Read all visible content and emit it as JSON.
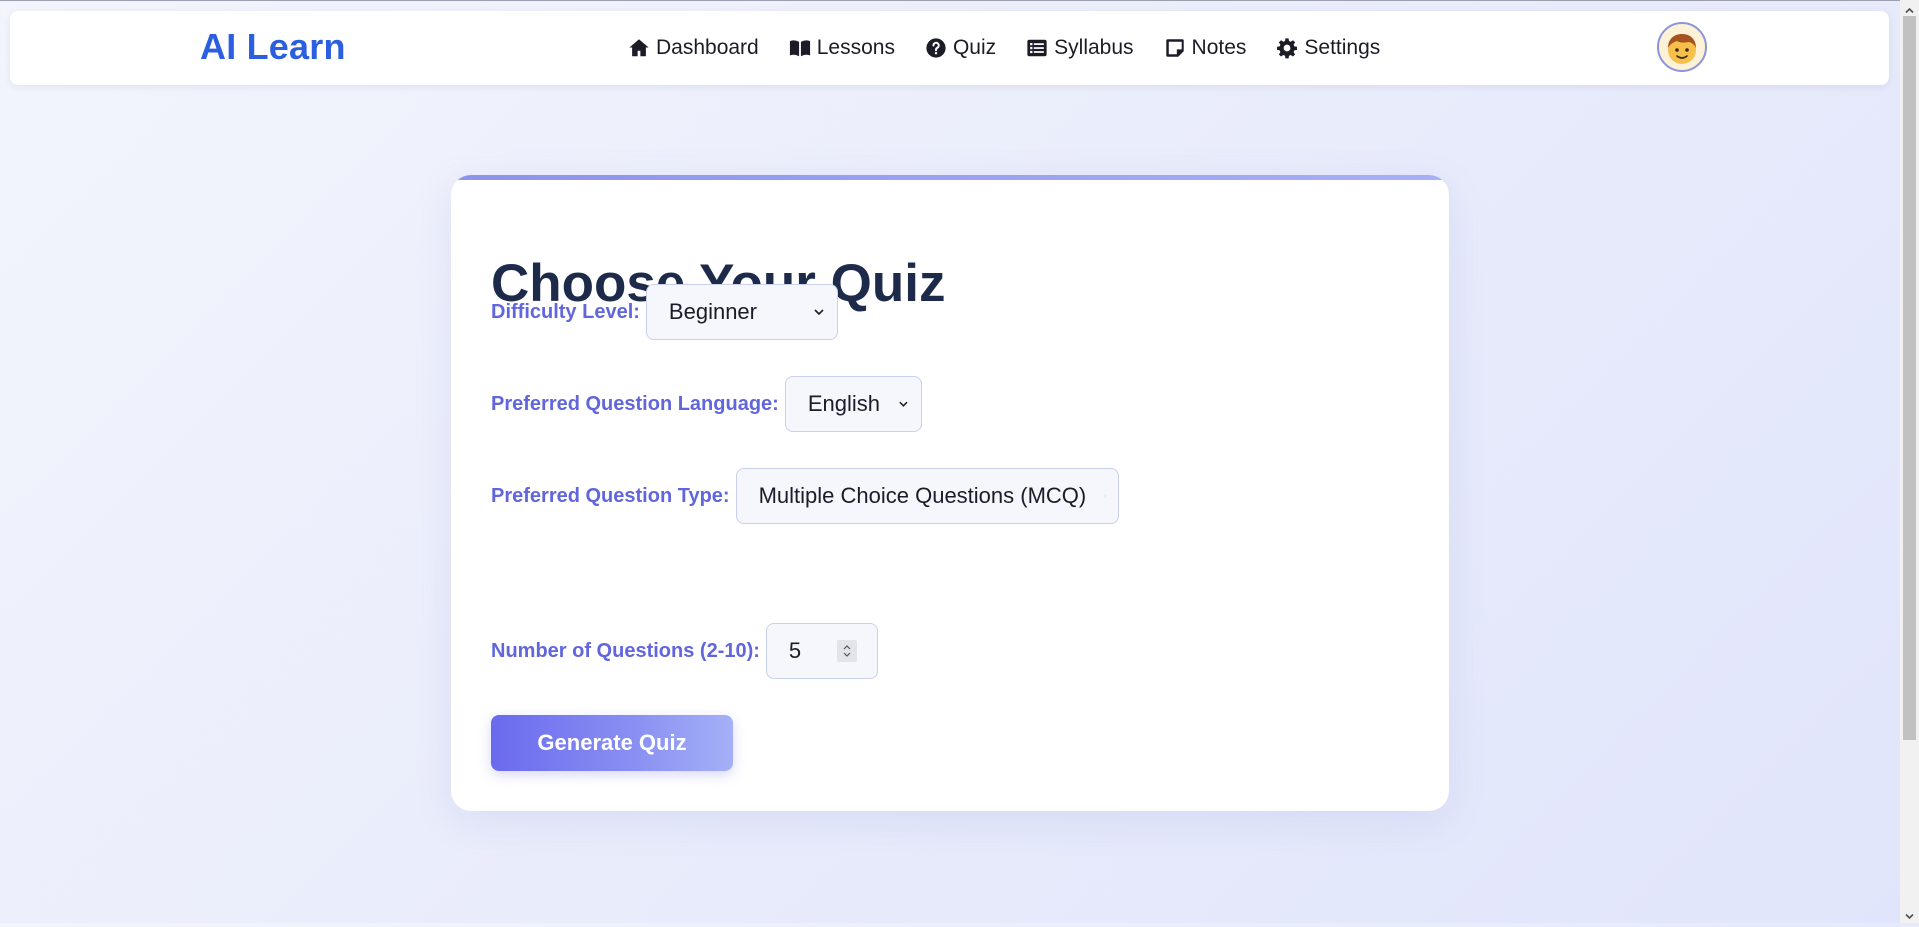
{
  "app": {
    "brand": "AI Learn"
  },
  "nav": {
    "items": [
      {
        "label": "Dashboard",
        "icon": "home-icon"
      },
      {
        "label": "Lessons",
        "icon": "book-icon"
      },
      {
        "label": "Quiz",
        "icon": "question-circle-icon"
      },
      {
        "label": "Syllabus",
        "icon": "list-icon"
      },
      {
        "label": "Notes",
        "icon": "note-icon"
      },
      {
        "label": "Settings",
        "icon": "gear-icon"
      }
    ],
    "avatar": "avatar-boy-icon"
  },
  "quiz_form": {
    "title": "Choose Your Quiz",
    "difficulty": {
      "label": "Difficulty Level:",
      "value": "Beginner"
    },
    "language": {
      "label": "Preferred Question Language:",
      "value": "English"
    },
    "question_type": {
      "label": "Preferred Question Type:",
      "value": "Multiple Choice Questions (MCQ)"
    },
    "count": {
      "label": "Number of Questions (2-10):",
      "value": "5"
    },
    "submit_label": "Generate Quiz"
  },
  "colors": {
    "brand": "#2b5fe0",
    "label": "#6166dc",
    "title": "#1e2a4a",
    "button_start": "#6a6aee",
    "button_end": "#a4b1f7"
  }
}
